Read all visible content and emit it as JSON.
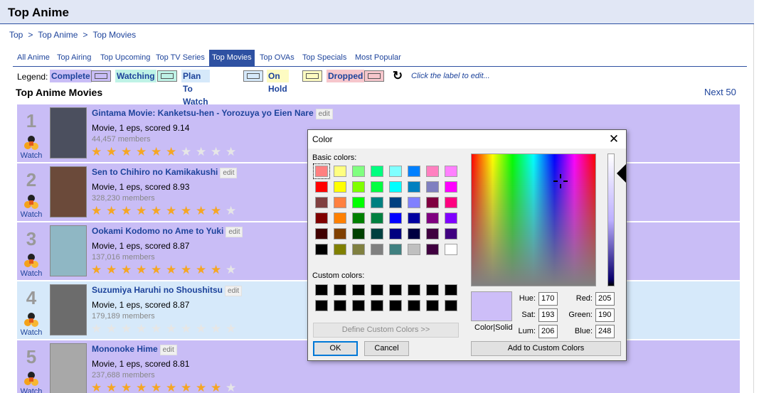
{
  "page": {
    "title": "Top Anime"
  },
  "breadcrumb": [
    "Top",
    "Top Anime",
    "Top Movies"
  ],
  "breadcrumb_sep": ">",
  "tabs": [
    {
      "label": "All Anime"
    },
    {
      "label": "Top Airing"
    },
    {
      "label": "Top Upcoming"
    },
    {
      "label": "Top TV Series"
    },
    {
      "label": "Top Movies",
      "active": true
    },
    {
      "label": "Top OVAs"
    },
    {
      "label": "Top Specials"
    },
    {
      "label": "Most Popular"
    }
  ],
  "legend": {
    "label": "Legend:",
    "items": [
      {
        "label": "Complete",
        "color": "#c9bdf6"
      },
      {
        "label": "Watching",
        "color": "#bff3e6"
      },
      {
        "label": "Plan To Watch",
        "color": "#d6e9fa"
      },
      {
        "label": "On Hold",
        "color": "#fdfbc2"
      },
      {
        "label": "Dropped",
        "color": "#f6c6cc"
      }
    ],
    "refresh_icon": "refresh-icon",
    "hint": "Click the label to edit..."
  },
  "list": {
    "heading": "Top Anime Movies",
    "next": "Next 50",
    "watch_label": "Watch",
    "edit_label": "edit",
    "items": [
      {
        "rank": "1",
        "title": "Gintama Movie: Kanketsu-hen - Yorozuya yo Eien Nare",
        "info": "Movie, 1 eps, scored 9.14",
        "members": "44,457 members",
        "stars": 6,
        "bg": "#c9bdf6"
      },
      {
        "rank": "2",
        "title": "Sen to Chihiro no Kamikakushi",
        "info": "Movie, 1 eps, scored 8.93",
        "members": "328,230 members",
        "stars": 9,
        "bg": "#c9bdf6"
      },
      {
        "rank": "3",
        "title": "Ookami Kodomo no Ame to Yuki",
        "info": "Movie, 1 eps, scored 8.87",
        "members": "137,016 members",
        "stars": 9,
        "bg": "#c9bdf6"
      },
      {
        "rank": "4",
        "title": "Suzumiya Haruhi no Shoushitsu",
        "info": "Movie, 1 eps, scored 8.87",
        "members": "179,189 members",
        "stars": 0,
        "bg": "#d6e9fa"
      },
      {
        "rank": "5",
        "title": "Mononoke Hime",
        "info": "Movie, 1 eps, scored 8.81",
        "members": "237,688 members",
        "stars": 9,
        "bg": "#c9bdf6"
      }
    ]
  },
  "dialog": {
    "title": "Color",
    "basic_label": "Basic colors:",
    "custom_label": "Custom colors:",
    "basic_colors": [
      "#ff8080",
      "#ffff80",
      "#80ff80",
      "#00ff80",
      "#80ffff",
      "#0080ff",
      "#ff80c0",
      "#ff80ff",
      "#ff0000",
      "#ffff00",
      "#80ff00",
      "#00ff40",
      "#00ffff",
      "#0080c0",
      "#8080c0",
      "#ff00ff",
      "#804040",
      "#ff8040",
      "#00ff00",
      "#008080",
      "#004080",
      "#8080ff",
      "#800040",
      "#ff0080",
      "#800000",
      "#ff8000",
      "#008000",
      "#008040",
      "#0000ff",
      "#0000a0",
      "#800080",
      "#8000ff",
      "#400000",
      "#804000",
      "#004000",
      "#004040",
      "#000080",
      "#000040",
      "#400040",
      "#400080",
      "#000000",
      "#808000",
      "#808040",
      "#808080",
      "#408080",
      "#c0c0c0",
      "#400040",
      "#ffffff"
    ],
    "custom_colors": [
      "#000000",
      "#000000",
      "#000000",
      "#000000",
      "#000000",
      "#000000",
      "#000000",
      "#000000",
      "#000000",
      "#000000",
      "#000000",
      "#000000",
      "#000000",
      "#000000",
      "#000000",
      "#000000"
    ],
    "define_button": "Define Custom Colors >>",
    "ok_button": "OK",
    "cancel_button": "Cancel",
    "add_button": "Add to Custom Colors",
    "preview_label": "Color|Solid",
    "preview_color": "#cdbef8",
    "hue_label": "Hue:",
    "hue": "170",
    "sat_label": "Sat:",
    "sat": "193",
    "lum_label": "Lum:",
    "lum": "206",
    "red_label": "Red:",
    "red": "205",
    "green_label": "Green:",
    "green": "190",
    "blue_label": "Blue:",
    "blue": "248"
  }
}
